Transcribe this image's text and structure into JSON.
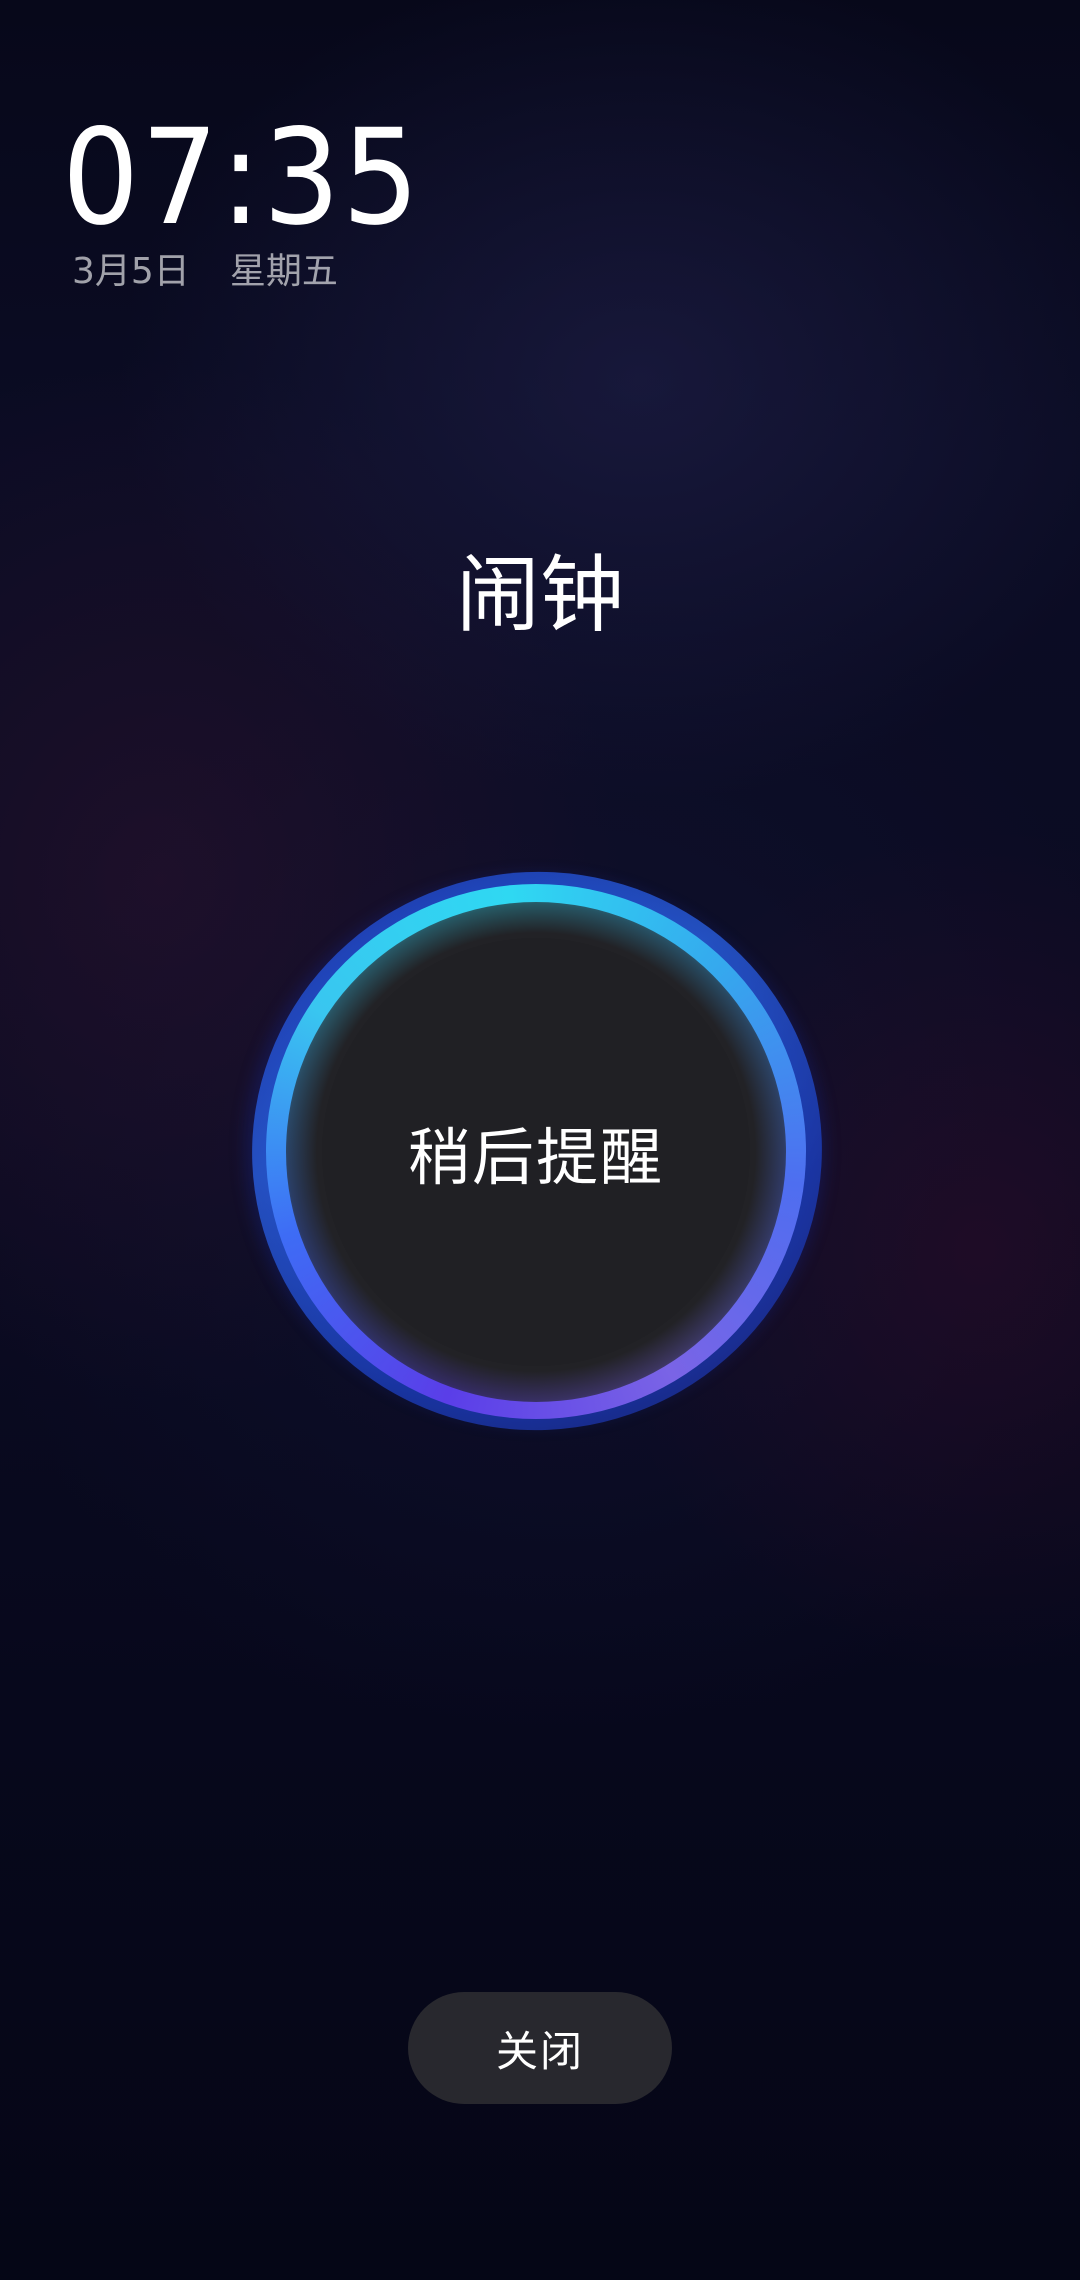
{
  "lock_clock": {
    "time": "07:35",
    "date": "3月5日",
    "weekday": "星期五"
  },
  "alarm": {
    "title": "闹钟",
    "snooze_label": "稍后提醒",
    "dismiss_label": "关闭"
  },
  "colors": {
    "background": "#0a0b20",
    "ring_cyan": "#2fd8f2",
    "ring_blue": "#2a63e8",
    "ring_violet": "#5a3ee8",
    "button_fill": "#202024",
    "dismiss_fill": "#28282e"
  }
}
